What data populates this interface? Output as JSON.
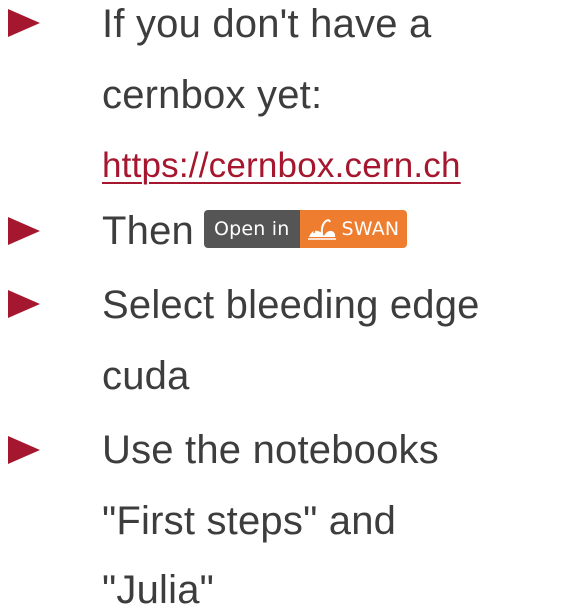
{
  "bullets": [
    {
      "lines": [
        "If you don't have a",
        "cernbox yet:"
      ],
      "link": "https://cernbox.cern.ch"
    },
    {
      "text": "Then",
      "badge": {
        "left": "Open in",
        "right": "SWAN",
        "icon": "swan-logo-icon"
      }
    },
    {
      "lines": [
        "Select bleeding edge",
        "cuda"
      ]
    },
    {
      "lines": [
        "Use the notebooks",
        "\"First steps\" and",
        "\"Julia\""
      ]
    }
  ],
  "colors": {
    "bullet": "#a5172e",
    "text": "#3d3d3d",
    "link": "#a5172e",
    "badge_left": "#555555",
    "badge_right": "#ee7d2f"
  }
}
